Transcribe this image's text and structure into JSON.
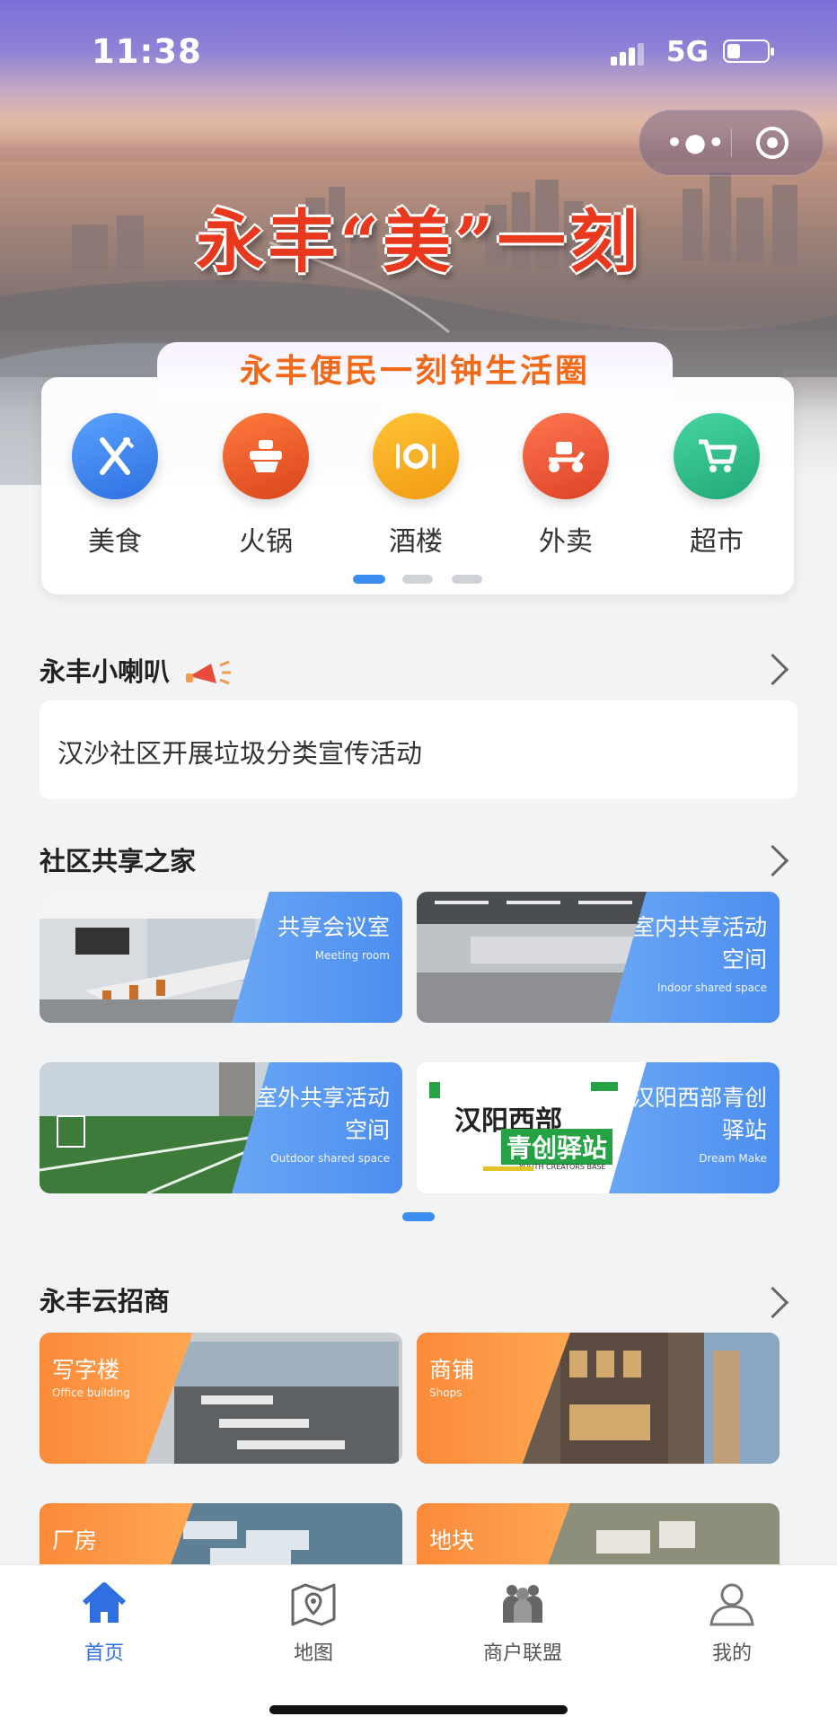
{
  "status_bar": {
    "time": "11:38",
    "network": "5G"
  },
  "hero": {
    "title": "永丰“美”一刻"
  },
  "categories": {
    "heading": "永丰便民一刻钟生活圈",
    "items": [
      {
        "label": "美食",
        "icon": "utensils-icon",
        "color": "#3b82e8"
      },
      {
        "label": "火锅",
        "icon": "hotpot-icon",
        "color": "#e8562a"
      },
      {
        "label": "酒楼",
        "icon": "dining-icon",
        "color": "#f5a623"
      },
      {
        "label": "外卖",
        "icon": "delivery-scooter-icon",
        "color": "#ec5a36"
      },
      {
        "label": "超市",
        "icon": "shopping-cart-icon",
        "color": "#2fbe8a"
      }
    ],
    "page_count": 3,
    "active_page": 1
  },
  "announcements": {
    "title": "永丰小喇叭",
    "icon": "megaphone-icon",
    "item": "汉沙社区开展垃圾分类宣传活动"
  },
  "shared_home": {
    "title": "社区共享之家",
    "tiles": [
      {
        "title": "共享会议室",
        "subtitle": "Meeting room"
      },
      {
        "title": "室内共享活动空间",
        "subtitle": "Indoor shared space"
      },
      {
        "title": "室外共享活动空间",
        "subtitle": "Outdoor shared space"
      },
      {
        "title": "汉阳西部青创驿站",
        "subtitle": "Dream Make",
        "logo_line1": "汉阳西部",
        "logo_line2": "青创驿站",
        "logo_small": "YOUTH CREATORS BASE"
      }
    ]
  },
  "investment": {
    "title": "永丰云招商",
    "tiles": [
      {
        "title": "写字楼",
        "subtitle": "Office building"
      },
      {
        "title": "商铺",
        "subtitle": "Shops"
      },
      {
        "title": "厂房",
        "subtitle": ""
      },
      {
        "title": "地块",
        "subtitle": ""
      }
    ]
  },
  "tabbar": {
    "items": [
      {
        "label": "首页",
        "icon": "home-icon",
        "active": true
      },
      {
        "label": "地图",
        "icon": "map-icon",
        "active": false
      },
      {
        "label": "商户联盟",
        "icon": "merchant-alliance-icon",
        "active": false
      },
      {
        "label": "我的",
        "icon": "profile-icon",
        "active": false
      }
    ]
  },
  "colors": {
    "accent": "#2f6fe0",
    "tile_blue": "#4b8ef0",
    "tile_orange": "#fb8a3a",
    "hero_title": "#e8381e"
  }
}
